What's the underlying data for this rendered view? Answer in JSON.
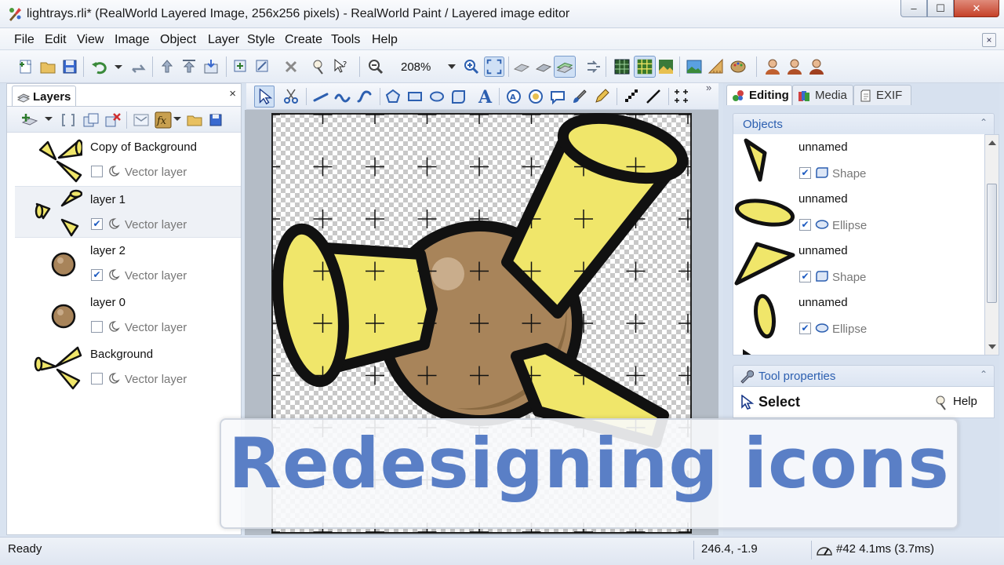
{
  "window": {
    "title": "lightrays.rli* (RealWorld Layered Image, 256x256 pixels) - RealWorld Paint / Layered image editor",
    "minimize": "–",
    "maximize": "☐",
    "close": "✕"
  },
  "menu": [
    "File",
    "Edit",
    "View",
    "Image",
    "Object",
    "Layer",
    "Style",
    "Create",
    "Tools",
    "Help"
  ],
  "toolbar": {
    "zoom": "208%"
  },
  "layers_panel": {
    "tab_label": "Layers",
    "close": "×",
    "layers": [
      {
        "name": "Copy of Background",
        "type": "Vector layer",
        "visible": false,
        "selected": false,
        "check": ""
      },
      {
        "name": "layer 1",
        "type": "Vector layer",
        "visible": true,
        "selected": true,
        "check": "✔"
      },
      {
        "name": "layer 2",
        "type": "Vector layer",
        "visible": true,
        "selected": false,
        "check": "✔"
      },
      {
        "name": "layer 0",
        "type": "Vector layer",
        "visible": false,
        "selected": false,
        "check": ""
      },
      {
        "name": "Background",
        "type": "Vector layer",
        "visible": false,
        "selected": false,
        "check": ""
      }
    ]
  },
  "right_panel": {
    "tabs": [
      {
        "label": "Editing",
        "active": true
      },
      {
        "label": "Media",
        "active": false
      },
      {
        "label": "EXIF",
        "active": false
      }
    ],
    "objects_title": "Objects",
    "collapse": "⌃",
    "objects": [
      {
        "name": "unnamed",
        "type": "Shape",
        "check": "✔"
      },
      {
        "name": "unnamed",
        "type": "Ellipse",
        "check": "✔"
      },
      {
        "name": "unnamed",
        "type": "Shape",
        "check": "✔"
      },
      {
        "name": "unnamed",
        "type": "Ellipse",
        "check": "✔"
      }
    ],
    "tool_properties_title": "Tool properties",
    "tool_name": "Select",
    "help_label": "Help"
  },
  "status": {
    "ready": "Ready",
    "coords": "246.4, -1.9",
    "perf": "#42 4.1ms (3.7ms)"
  },
  "overlay": {
    "text": "Redesigning icons"
  },
  "colors": {
    "accent": "#2c5fb0",
    "overlay_text": "#5a7fc6",
    "ray_yellow": "#f0e66a",
    "ball_brown": "#a8845a"
  }
}
